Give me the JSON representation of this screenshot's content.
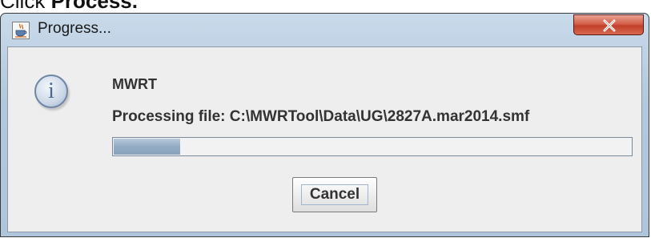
{
  "caption": {
    "prefix": "Click ",
    "bold": "Process."
  },
  "window": {
    "title": "Progress...",
    "app_icon": "java-cup-icon",
    "close_icon": "close-x-icon"
  },
  "dialog": {
    "icon": "info-icon",
    "icon_glyph": "i",
    "heading": "MWRT",
    "message": "Processing file: C:\\MWRTool\\Data\\UG\\2827A.mar2014.smf",
    "progress_fraction": 0.13,
    "cancel_label": "Cancel"
  },
  "colors": {
    "progress_fill": "#93abc4",
    "close_button": "#c2402a",
    "titlebar": "#b3c8dc"
  }
}
